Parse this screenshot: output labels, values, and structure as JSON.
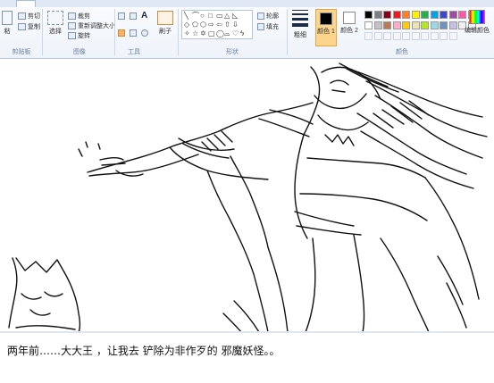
{
  "ribbon": {
    "clipboard": {
      "paste_label": "粘",
      "cut_label": "剪切",
      "copy_label": "复制",
      "group_label": "剪贴板"
    },
    "image": {
      "select_label": "选择",
      "crop_label": "裁剪",
      "resize_label": "重新调整大小",
      "rotate_label": "旋转",
      "group_label": "图像"
    },
    "tools": {
      "text_glyph": "A",
      "group_label": "工具"
    },
    "brushes": {
      "label": "刷子"
    },
    "shapes": {
      "outline_label": "轮廓",
      "fill_label": "填充",
      "group_label": "形状",
      "glyphs": [
        "╲",
        "⌒",
        "○",
        "□",
        "▭",
        "△",
        "◺",
        "◇",
        "⬠",
        "⬡",
        "⇨",
        "⇦",
        "⇧",
        "⇩",
        "✧",
        "☆",
        "✡",
        "▢",
        "◯",
        "⌓",
        "♡",
        "ϟ"
      ]
    },
    "size": {
      "label": "粗细"
    },
    "colors": {
      "color1_label": "颜色 1",
      "color2_label": "颜色 2",
      "edit_label": "编辑颜色",
      "group_label": "颜色",
      "color1": "#000000",
      "color2": "#ffffff",
      "palette_row1": [
        "#000000",
        "#7f7f7f",
        "#880015",
        "#ed1c24",
        "#ff7f27",
        "#fff200",
        "#22b14c",
        "#00a2e8",
        "#3f48cc",
        "#a349a4",
        "#ff55aa",
        "#ff8c00"
      ],
      "palette_row2": [
        "#ffffff",
        "#c3c3c3",
        "#b97a57",
        "#ffaec9",
        "#ffc90e",
        "#efe4b0",
        "#b5e61d",
        "#99d9ea",
        "#7092be",
        "#c8bfe7",
        "#f0f0f0",
        "#f0f0f0"
      ]
    }
  },
  "caption": "两年前……大大王 ，让我去 铲除为非作歹的 邪魔妖怪。。"
}
